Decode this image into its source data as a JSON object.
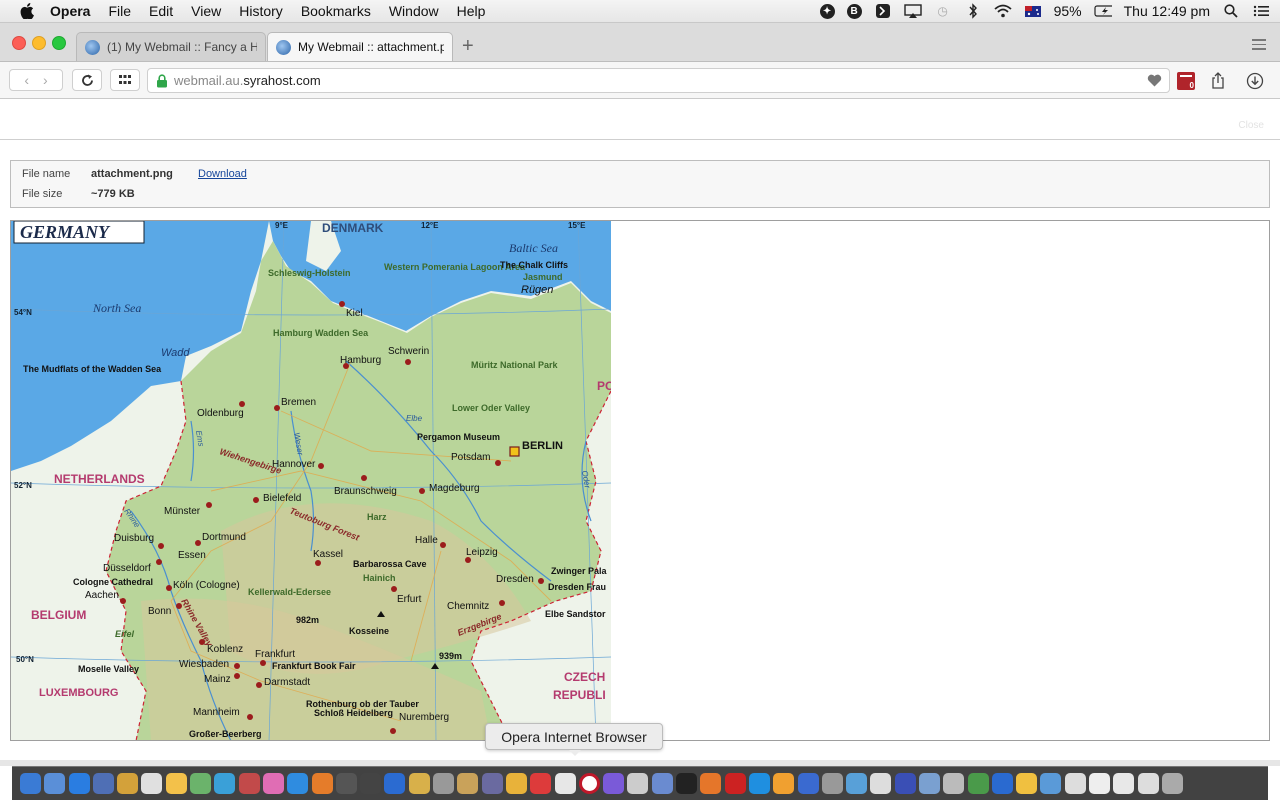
{
  "menubar": {
    "app": "Opera",
    "items": [
      "File",
      "Edit",
      "View",
      "History",
      "Bookmarks",
      "Window",
      "Help"
    ],
    "battery": "95%",
    "clock": "Thu 12:49 pm"
  },
  "tabs": [
    {
      "label": "(1) My Webmail :: Fancy a Ha",
      "active": false
    },
    {
      "label": "My Webmail :: attachment.pn",
      "active": true
    }
  ],
  "address": {
    "url_prefix": "webmail.au.",
    "url_domain": "syrahost.com",
    "ext_badge": "0"
  },
  "page": {
    "close_label": "Close",
    "file_name_label": "File name",
    "file_name": "attachment.png",
    "download_label": "Download",
    "file_size_label": "File size",
    "file_size": "~779 KB"
  },
  "map": {
    "title": "GERMANY",
    "countries": [
      "DENMARK",
      "NETHERLANDS",
      "BELGIUM",
      "LUXEMBOURG",
      "CZECH",
      "REPUBLI",
      "PO"
    ],
    "seas": [
      "North Sea",
      "Baltic Sea"
    ],
    "graticule": [
      "9°E",
      "12°E",
      "15°E",
      "54°N",
      "52°N",
      "50°N"
    ],
    "capital": "BERLIN",
    "cities": [
      "Kiel",
      "Hamburg",
      "Schwerin",
      "Bremen",
      "Oldenburg",
      "Hannover",
      "Potsdam",
      "Braunschweig",
      "Magdeburg",
      "Bielefeld",
      "Münster",
      "Dortmund",
      "Duisburg",
      "Essen",
      "Düsseldorf",
      "Köln (Cologne)",
      "Aachen",
      "Bonn",
      "Kassel",
      "Halle",
      "Leipzig",
      "Erfurt",
      "Dresden",
      "Chemnitz",
      "Koblenz",
      "Wiesbaden",
      "Frankfurt",
      "Mainz",
      "Darmstadt",
      "Mannheim",
      "Nuremberg"
    ],
    "attractions": [
      "Schleswig-Holstein",
      "Western Pomerania Lagoon Area",
      "The Chalk Cliffs",
      "Jasmund",
      "Rügen",
      "Hamburg Wadden Sea",
      "The Mudflats of the Wadden Sea",
      "Müritz National Park",
      "Lower Oder Valley",
      "Pergamon Museum",
      "Harz",
      "Barbarossa Cave",
      "Hainich",
      "Kellerwald-Edersee",
      "Cologne Cathedral",
      "Zwinger Pala",
      "Dresden Frau",
      "Elbe Sandstor",
      "Moselle Valley",
      "Frankfurt Book Fair",
      "Rothenburg ob der Tauber",
      "Schloß Heidelberg",
      "Großer-Beerberg",
      "982m",
      "Kosseine",
      "939m"
    ],
    "regions": [
      "Wiehengebirge",
      "Teutoburg Forest",
      "Rhine Valley",
      "Erzgebirge",
      "Eifel"
    ],
    "rivers": [
      "Elbe",
      "Weser",
      "Ems",
      "Rhine",
      "Oder",
      "Wadd"
    ]
  },
  "tooltip": "Opera Internet Browser",
  "dock_count": 48,
  "colors": {
    "link": "#16469b",
    "sea": "#5aa8e6",
    "land": "#b9d59a",
    "neighbour": "#eef3ea",
    "city_dot": "#9b1c1c"
  }
}
